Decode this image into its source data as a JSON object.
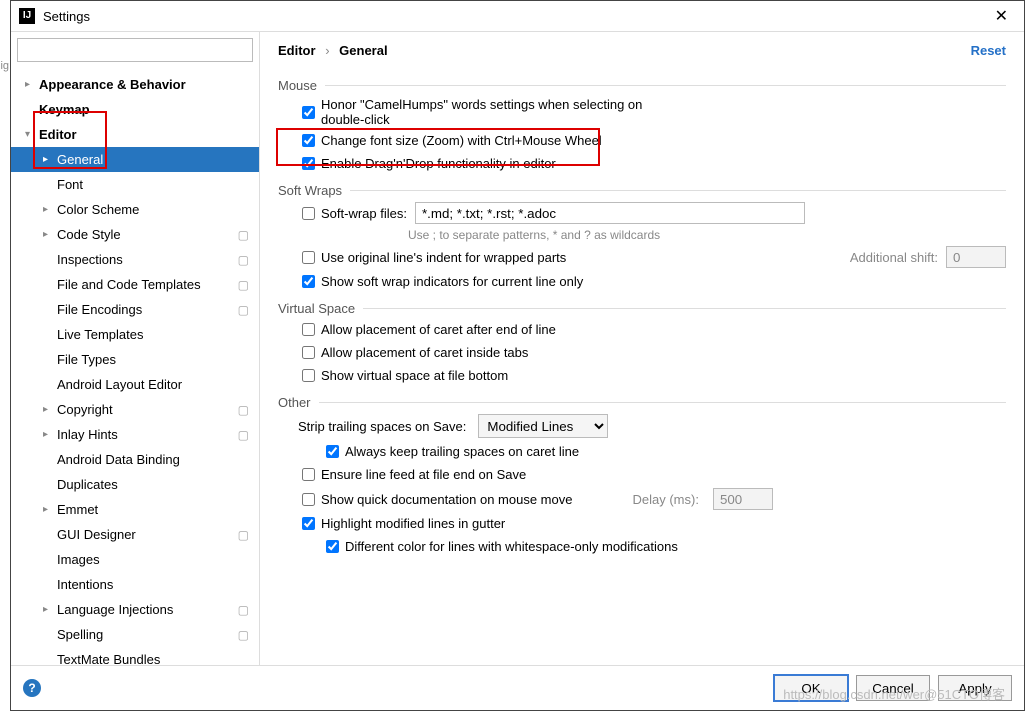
{
  "window": {
    "title": "Settings"
  },
  "search": {
    "placeholder": ""
  },
  "tree": {
    "appearance": "Appearance & Behavior",
    "keymap": "Keymap",
    "editor": "Editor",
    "general": "General",
    "font": "Font",
    "color_scheme": "Color Scheme",
    "code_style": "Code Style",
    "inspections": "Inspections",
    "file_code_templates": "File and Code Templates",
    "file_encodings": "File Encodings",
    "live_templates": "Live Templates",
    "file_types": "File Types",
    "android_layout_editor": "Android Layout Editor",
    "copyright": "Copyright",
    "inlay_hints": "Inlay Hints",
    "android_data_binding": "Android Data Binding",
    "duplicates": "Duplicates",
    "emmet": "Emmet",
    "gui_designer": "GUI Designer",
    "images": "Images",
    "intentions": "Intentions",
    "language_injections": "Language Injections",
    "spelling": "Spelling",
    "textmate_bundles": "TextMate Bundles"
  },
  "breadcrumb": {
    "a": "Editor",
    "b": "General"
  },
  "reset": "Reset",
  "groups": {
    "mouse": "Mouse",
    "soft_wraps": "Soft Wraps",
    "virtual_space": "Virtual Space",
    "other": "Other"
  },
  "opts": {
    "honor": "Honor \"CamelHumps\" words settings when selecting on double-click",
    "change_font": "Change font size (Zoom) with Ctrl+Mouse Wheel",
    "drag_drop": "Enable Drag'n'Drop functionality in editor",
    "soft_wrap_files": "Soft-wrap files:",
    "soft_wrap_value": "*.md; *.txt; *.rst; *.adoc",
    "soft_wrap_hint": "Use ; to separate patterns, * and ? as wildcards",
    "orig_indent": "Use original line's indent for wrapped parts",
    "addl_shift": "Additional shift:",
    "addl_shift_val": "0",
    "show_indicators": "Show soft wrap indicators for current line only",
    "caret_end": "Allow placement of caret after end of line",
    "caret_tabs": "Allow placement of caret inside tabs",
    "virt_bottom": "Show virtual space at file bottom",
    "strip_label": "Strip trailing spaces on Save:",
    "strip_val": "Modified Lines",
    "keep_trailing": "Always keep trailing spaces on caret line",
    "line_feed": "Ensure line feed at file end on Save",
    "quick_doc": "Show quick documentation on mouse move",
    "delay_label": "Delay (ms):",
    "delay_val": "500",
    "highlight_mod": "Highlight modified lines in gutter",
    "diff_color": "Different color for lines with whitespace-only modifications"
  },
  "buttons": {
    "ok": "OK",
    "cancel": "Cancel",
    "apply": "Apply"
  },
  "watermark": "https://blog.csdn.net/wer@51CTO博客"
}
